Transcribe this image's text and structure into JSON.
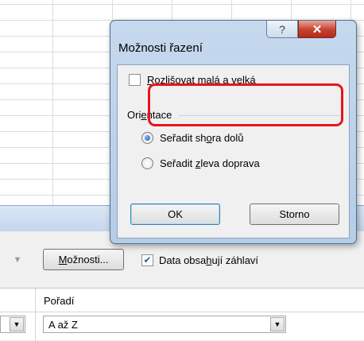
{
  "options_dialog": {
    "title": "Možnosti řazení",
    "help_glyph": "?",
    "close_glyph": "✕",
    "case_checkbox": {
      "label_pre": "",
      "label_accel": "R",
      "label_post": "ozlišovat malá a velká",
      "checked": false
    },
    "orientation_label_pre": "Ori",
    "orientation_label_accel": "e",
    "orientation_label_post": "ntace",
    "radio_top_to_bottom": {
      "pre": "Seřadit sh",
      "accel": "o",
      "post": "ra dolů",
      "selected": true
    },
    "radio_left_to_right": {
      "pre": "Seřadit ",
      "accel": "z",
      "post": "leva doprava",
      "selected": false
    },
    "ok_label": "OK",
    "cancel_label": "Storno"
  },
  "sort_dialog": {
    "options_button_pre": "",
    "options_button_accel": "M",
    "options_button_post": "ožnosti...",
    "header_checkbox": {
      "pre": "Data obsa",
      "accel": "h",
      "post": "ují záhlaví",
      "checked": true
    },
    "column_header_order": "Pořadí",
    "order_value": "A až Z"
  },
  "colors": {
    "highlight_box": "#e8141b",
    "dialog_frame": "#b6cde7",
    "radio_selected": "#1557b3"
  }
}
